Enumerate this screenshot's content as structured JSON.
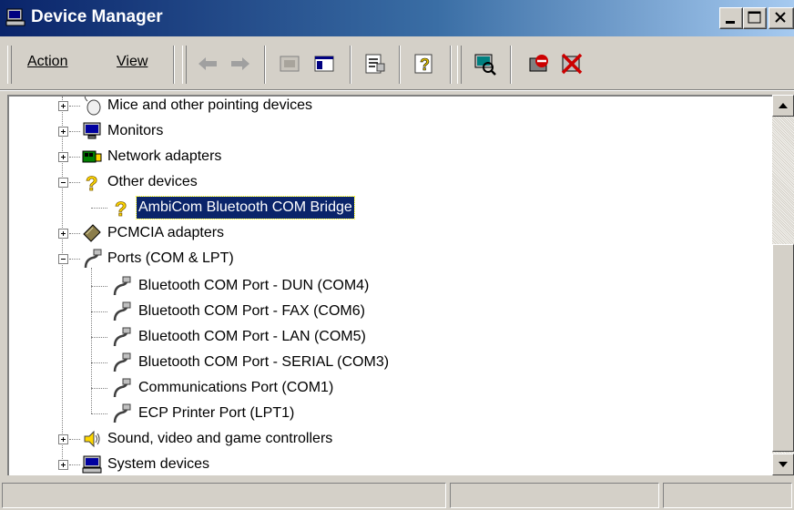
{
  "window": {
    "title": "Device Manager"
  },
  "menu": {
    "action": "Action",
    "view": "View"
  },
  "toolbar_icons": [
    "back-arrow-icon",
    "forward-arrow-icon",
    "up-folder-icon",
    "show-hide-tree-icon",
    "properties-icon",
    "help-icon",
    "scan-hardware-icon",
    "disable-device-icon",
    "uninstall-device-icon"
  ],
  "tree": {
    "mice": "Mice and other pointing devices",
    "monitors": "Monitors",
    "network": "Network adapters",
    "other": "Other devices",
    "ambicom": "AmbiCom Bluetooth COM Bridge",
    "pcmcia": "PCMCIA adapters",
    "ports": "Ports (COM & LPT)",
    "port_dun": "Bluetooth COM Port - DUN (COM4)",
    "port_fax": "Bluetooth COM Port - FAX (COM6)",
    "port_lan": "Bluetooth COM Port - LAN (COM5)",
    "port_serial": "Bluetooth COM Port - SERIAL (COM3)",
    "port_com1": "Communications Port (COM1)",
    "port_lpt1": "ECP Printer Port (LPT1)",
    "sound": "Sound, video and game controllers",
    "system": "System devices"
  },
  "colors": {
    "titlebar_start": "#0a246a",
    "titlebar_end": "#a6caf0",
    "selection": "#0a246a",
    "chrome": "#d4d0c8"
  }
}
